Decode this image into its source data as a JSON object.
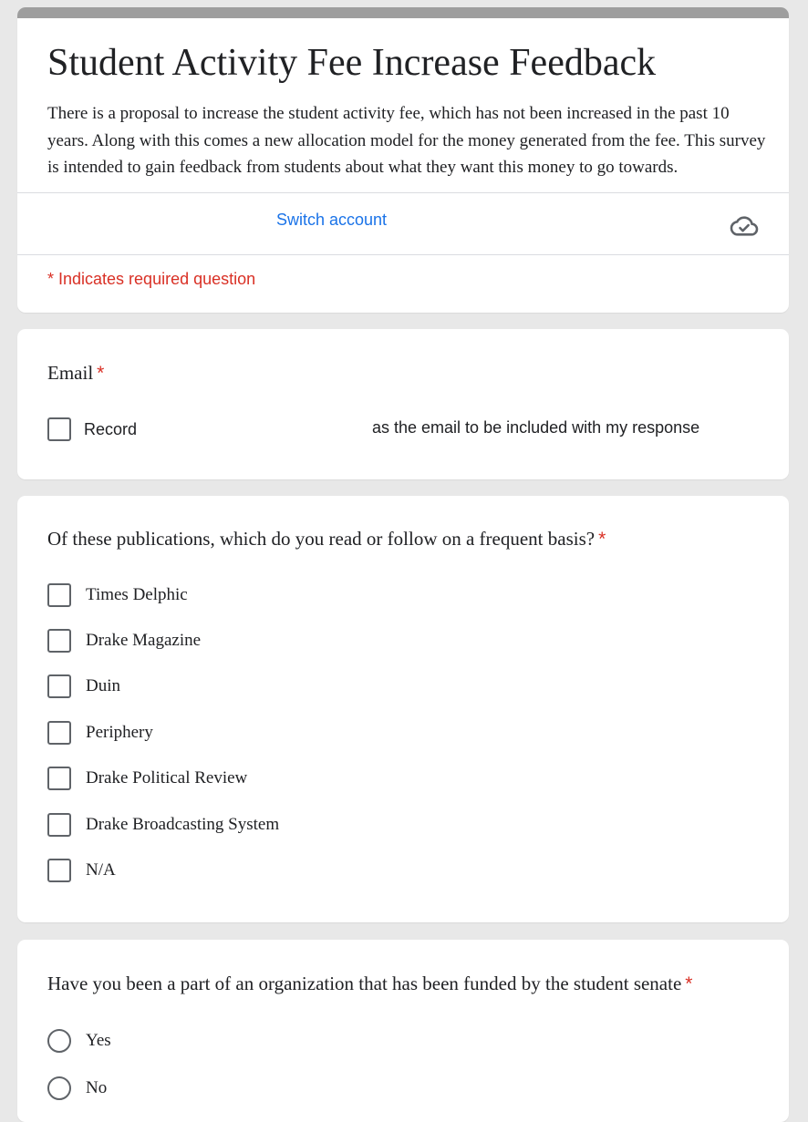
{
  "header": {
    "title": "Student Activity Fee Increase Feedback",
    "description": "There is a proposal to increase the student activity fee, which has not been increased in the past 10 years.  Along with this comes a new allocation model for the money generated from the fee. This survey is intended to gain feedback from students about what they want this money to go towards.",
    "account_email": "",
    "switch_account_label": "Switch account",
    "cloud_icon": "cloud-saved-icon",
    "required_note": "* Indicates required question"
  },
  "colors": {
    "background": "#e8e8e8",
    "header_band": "#9e9e9e",
    "link": "#1a73e8",
    "required": "#d93025"
  },
  "questions": {
    "email": {
      "title": "Email",
      "required_mark": "*",
      "record_label": "Record",
      "record_suffix": "as the email to be included with my response",
      "checked": false
    },
    "publications": {
      "title": "Of these publications, which do you read or follow on a frequent basis?",
      "required_mark": "*",
      "options": [
        {
          "label": "Times Delphic",
          "checked": false
        },
        {
          "label": "Drake Magazine",
          "checked": false
        },
        {
          "label": "Duin",
          "checked": false
        },
        {
          "label": "Periphery",
          "checked": false
        },
        {
          "label": "Drake Political Review",
          "checked": false
        },
        {
          "label": "Drake Broadcasting System",
          "checked": false
        },
        {
          "label": "N/A",
          "checked": false
        }
      ]
    },
    "senate": {
      "title": "Have you been a part of an organization that has been funded by the student senate",
      "required_mark": "*",
      "options": [
        {
          "label": "Yes",
          "selected": false
        },
        {
          "label": "No",
          "selected": false
        }
      ]
    }
  }
}
